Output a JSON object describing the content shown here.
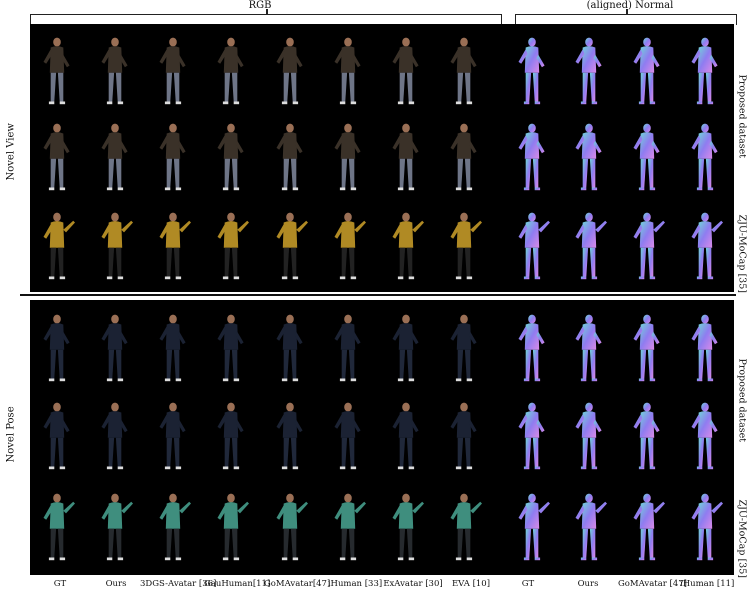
{
  "header": {
    "rgb": "RGB",
    "normal": "(aligned) Normal"
  },
  "sections": [
    {
      "side_label": "Novel View",
      "rows": [
        {
          "dataset": "Proposed dataset",
          "subject": "brown"
        },
        {
          "dataset": "Proposed dataset",
          "subject": "brown"
        },
        {
          "dataset": "ZJU-MoCap [35]",
          "subject": "yellow"
        }
      ]
    },
    {
      "side_label": "Novel Pose",
      "rows": [
        {
          "dataset": "Proposed dataset",
          "subject": "navy"
        },
        {
          "dataset": "Proposed dataset",
          "subject": "navy"
        },
        {
          "dataset": "ZJU-MoCap [35]",
          "subject": "teal"
        }
      ]
    }
  ],
  "right_labels": [
    "Proposed dataset",
    "ZJU-MoCap [35]",
    "Proposed dataset",
    "ZJU-MoCap [35]"
  ],
  "rgb_columns": [
    "GT",
    "Ours",
    "3DGS-Avatar [36]",
    "GauHuman[11]",
    "GoMAvatar[47]",
    "iHuman [33]",
    "ExAvatar [30]",
    "EVA [10]"
  ],
  "normal_columns": [
    "GT",
    "Ours",
    "GoMAvatar [47]",
    "iHuman [11]"
  ],
  "colors": {
    "brown": "#3a3128",
    "yellow": "#b08a24",
    "navy": "#1b2233",
    "teal": "#3f8e7e",
    "skin": "#9a6f55",
    "pants_brown": "#6e7587",
    "pants_yellow": "#222",
    "pants_navy": "#20283a",
    "pants_teal": "#262a2e",
    "normal_a": "#8f7cf0",
    "normal_b": "#d98ae8",
    "normal_c": "#6fd6d8"
  }
}
